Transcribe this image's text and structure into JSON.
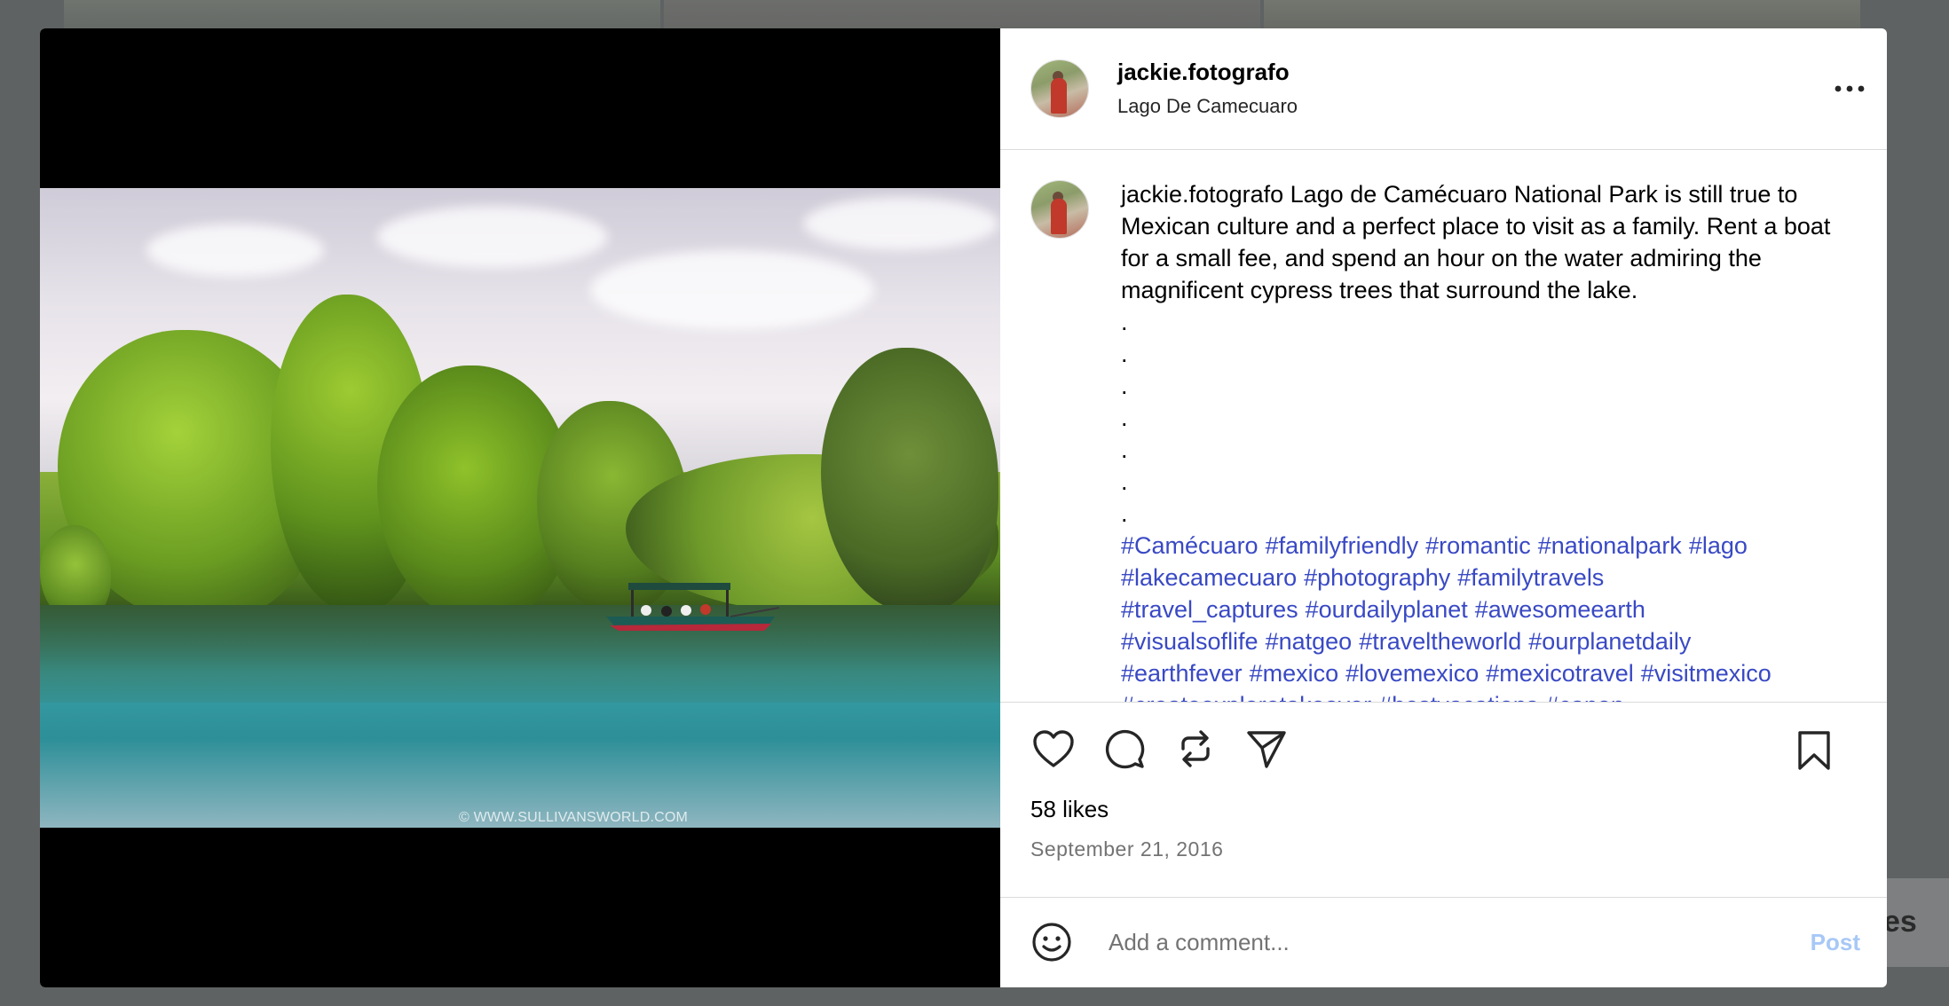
{
  "background": {
    "side_text": "es"
  },
  "post": {
    "author": "jackie.fotografo",
    "location": "Lago De Camecuaro",
    "image": {
      "watermark": "© WWW.SULLIVANSWORLD.COM"
    },
    "caption": {
      "username": "jackie.fotografo",
      "text": "Lago de Camécuaro National Park is still true to Mexican culture and a perfect place to visit as a family. Rent a boat for a small fee, and spend an hour on the water admiring the magnificent cypress trees that surround the lake.",
      "dots": [
        ".",
        ".",
        ".",
        ".",
        ".",
        ".",
        "."
      ],
      "hashtags": [
        "#Camécuaro",
        "#familyfriendly",
        "#romantic",
        "#nationalpark",
        "#lago",
        "#lakecamecuaro",
        "#photography",
        "#familytravels",
        "#travel_captures",
        "#ourdailyplanet",
        "#awesomeearth",
        "#visualsoflife",
        "#natgeo",
        "#traveltheworld",
        "#ourplanetdaily",
        "#earthfever",
        "#mexico",
        "#lovemexico",
        "#mexicotravel",
        "#visitmexico",
        "#createexploretakeover",
        "#bestvacations",
        "#canon"
      ]
    },
    "likes": "58 likes",
    "date": "September 21, 2016"
  },
  "icons": {
    "more": "more-horizontal-icon",
    "like": "heart-icon",
    "comment": "comment-bubble-icon",
    "repost": "repost-icon",
    "share": "paper-plane-icon",
    "save": "bookmark-icon",
    "emoji": "emoji-smile-icon"
  },
  "comment": {
    "placeholder": "Add a comment...",
    "post_label": "Post"
  },
  "colors": {
    "hashtag": "#3949c4",
    "post_disabled": "#a7c8f7",
    "muted": "#737373"
  }
}
